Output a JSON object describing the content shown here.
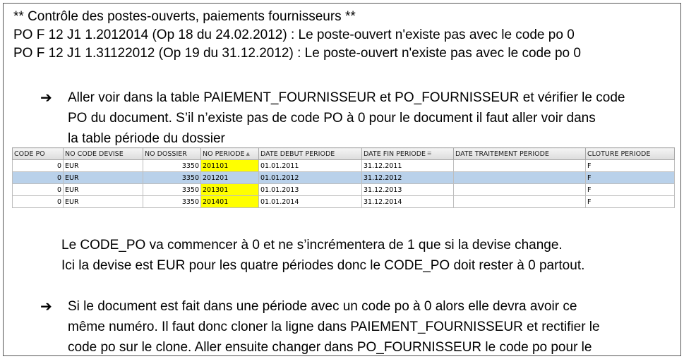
{
  "header": {
    "line1": "** Contrôle des postes-ouverts, paiements fournisseurs **",
    "line2": "PO F 12 J1 1.2012014 (Op 18 du 24.02.2012) : Le poste-ouvert n'existe pas avec le code po 0",
    "line3": "PO F 12 J1 1.31122012 (Op 19 du 31.12.2012) : Le poste-ouvert n'existe pas avec le code po 0"
  },
  "bullet1": {
    "arrow": "➔",
    "line1": "Aller voir dans la table PAIEMENT_FOURNISSEUR et PO_FOURNISSEUR et vérifier le code",
    "line2": "PO du document. S’il n’existe pas de code PO à 0 pour le document il faut aller voir dans",
    "line3": "la table période du dossier"
  },
  "table": {
    "columns": [
      "CODE PO",
      "NO CODE DEVISE",
      "NO DOSSIER",
      "NO PERIODE",
      "DATE DEBUT PERIODE",
      "DATE FIN PERIODE",
      "DATE TRAITEMENT PERIODE",
      "CLOTURE PERIODE"
    ],
    "rows": [
      [
        "0",
        "EUR",
        "3350",
        "201101",
        "01.01.2011",
        "31.12.2011",
        "",
        "F"
      ],
      [
        "0",
        "EUR",
        "3350",
        "201201",
        "01.01.2012",
        "31.12.2012",
        "",
        "F"
      ],
      [
        "0",
        "EUR",
        "3350",
        "201301",
        "01.01.2013",
        "31.12.2013",
        "",
        "F"
      ],
      [
        "0",
        "EUR",
        "3350",
        "201401",
        "01.01.2014",
        "31.12.2014",
        "",
        "F"
      ]
    ],
    "selected_row_index": 1,
    "highlight_color": "#ffff00",
    "selection_color": "#b9d1ea"
  },
  "note": {
    "line1": "Le CODE_PO va commencer à 0 et ne s’incrémentera de 1 que si la devise change.",
    "line2": "Ici la devise est EUR pour les quatre périodes donc le CODE_PO doit rester à 0 partout."
  },
  "bullet2": {
    "arrow": "➔",
    "line1": "Si le document est fait dans une période avec un code po à 0 alors elle devra avoir ce",
    "line2": "même numéro. Il faut donc cloner la ligne dans PAIEMENT_FOURNISSEUR et rectifier le",
    "line3": "code po sur le clone. Aller ensuite changer dans PO_FOURNISSEUR le code po pour le"
  }
}
